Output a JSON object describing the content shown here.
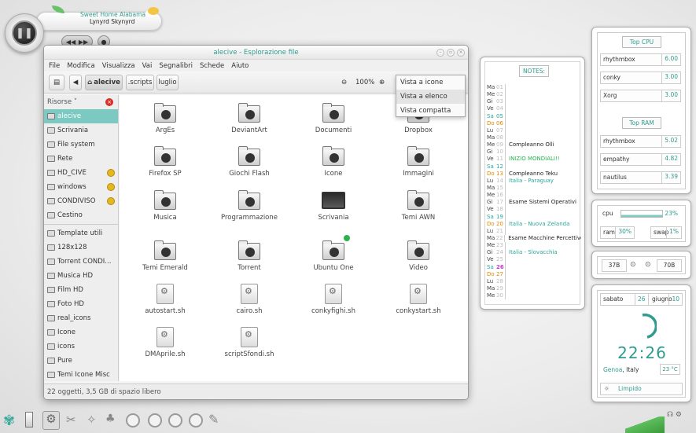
{
  "player": {
    "title": "Sweet Home Alabama",
    "artist": "Lynyrd Skynyrd"
  },
  "window": {
    "title": "alecive - Esplorazione file",
    "menu": [
      "File",
      "Modifica",
      "Visualizza",
      "Vai",
      "Segnalibri",
      "Schede",
      "Aiuto"
    ],
    "breadcrumbs": [
      "alecive",
      ".scripts",
      "luglio"
    ],
    "zoom": "100%",
    "view_menu": [
      "Vista a icone",
      "Vista a elenco",
      "Vista compatta"
    ],
    "sidebar_header": "Risorse",
    "places": [
      "alecive",
      "Scrivania",
      "File system",
      "Rete",
      "HD_CIVE",
      "windows",
      "CONDIVISO",
      "Cestino"
    ],
    "bookmarks": [
      "Template utili",
      "128x128",
      "Torrent CONDI...",
      "Musica HD",
      "Film HD",
      "Foto HD",
      "real_icons",
      "Icone",
      "icons",
      "Pure",
      "Temi Icone Misc"
    ],
    "files": [
      "ArgEs",
      "DeviantArt",
      "Documenti",
      "Dropbox",
      "Firefox SP",
      "Giochi Flash",
      "Icone",
      "Immagini",
      "Musica",
      "Programmazione",
      "Scrivania",
      "Temi AWN",
      "Temi Emerald",
      "Torrent",
      "Ubuntu One",
      "Video",
      "autostart.sh",
      "cairo.sh",
      "conkyfighi.sh",
      "conkystart.sh",
      "DMAprile.sh",
      "scriptSfondi.sh"
    ],
    "status": "22 oggetti, 3,5 GB di spazio libero"
  },
  "notes": {
    "header": "NOTES:",
    "rows": [
      {
        "d": "Ma",
        "n": "01",
        "e": ""
      },
      {
        "d": "Me",
        "n": "02",
        "e": ""
      },
      {
        "d": "Gi",
        "n": "03",
        "e": ""
      },
      {
        "d": "Ve",
        "n": "04",
        "e": ""
      },
      {
        "d": "Sa",
        "n": "05",
        "e": ""
      },
      {
        "d": "Do",
        "n": "06",
        "e": ""
      },
      {
        "d": "Lu",
        "n": "07",
        "e": ""
      },
      {
        "d": "Ma",
        "n": "08",
        "e": ""
      },
      {
        "d": "Me",
        "n": "09",
        "e": "Compleanno Olli"
      },
      {
        "d": "Gi",
        "n": "10",
        "e": ""
      },
      {
        "d": "Ve",
        "n": "11",
        "e": "INIZIO MONDIALI!!"
      },
      {
        "d": "Sa",
        "n": "12",
        "e": ""
      },
      {
        "d": "Do",
        "n": "13",
        "e": "Compleanno Teku"
      },
      {
        "d": "Lu",
        "n": "14",
        "e": "Italia - Paraguay"
      },
      {
        "d": "Ma",
        "n": "15",
        "e": ""
      },
      {
        "d": "Me",
        "n": "16",
        "e": ""
      },
      {
        "d": "Gi",
        "n": "17",
        "e": "Esame Sistemi Operativi"
      },
      {
        "d": "Ve",
        "n": "18",
        "e": ""
      },
      {
        "d": "Sa",
        "n": "19",
        "e": ""
      },
      {
        "d": "Do",
        "n": "20",
        "e": "Italia - Nuova Zelanda"
      },
      {
        "d": "Lu",
        "n": "21",
        "e": ""
      },
      {
        "d": "Ma",
        "n": "22",
        "e": "Esame Macchine Percettive"
      },
      {
        "d": "Me",
        "n": "23",
        "e": ""
      },
      {
        "d": "Gi",
        "n": "24",
        "e": "Italia - Slovacchia"
      },
      {
        "d": "Ve",
        "n": "25",
        "e": ""
      },
      {
        "d": "Sa",
        "n": "26",
        "e": ""
      },
      {
        "d": "Do",
        "n": "27",
        "e": ""
      },
      {
        "d": "Lu",
        "n": "28",
        "e": ""
      },
      {
        "d": "Ma",
        "n": "29",
        "e": ""
      },
      {
        "d": "Me",
        "n": "30",
        "e": ""
      }
    ]
  },
  "top_cpu": {
    "header": "Top CPU",
    "rows": [
      {
        "name": "rhythmbox",
        "val": "6.00"
      },
      {
        "name": "conky",
        "val": "3.00"
      },
      {
        "name": "Xorg",
        "val": "3.00"
      }
    ]
  },
  "top_ram": {
    "header": "Top RAM",
    "rows": [
      {
        "name": "rhythmbox",
        "val": "5.02"
      },
      {
        "name": "empathy",
        "val": "4.82"
      },
      {
        "name": "nautilus",
        "val": "3.39"
      }
    ]
  },
  "sys": {
    "cpu_label": "cpu",
    "cpu_val": "23%",
    "ram_label": "ram",
    "ram_val": "30%",
    "swap_label": "swap",
    "swap_val": "1%"
  },
  "net": {
    "down": "37B",
    "up": "70B"
  },
  "clock": {
    "day": "sabato",
    "date": "26",
    "month": "giugno",
    "num": "10",
    "time": "22:26",
    "city": "Genoa",
    "country": "Italy",
    "temp": "23 °C",
    "weather": "Limpido"
  },
  "colors": {
    "accent": "#2f9c8f",
    "sidebar_sel": "#7cc9c1"
  }
}
